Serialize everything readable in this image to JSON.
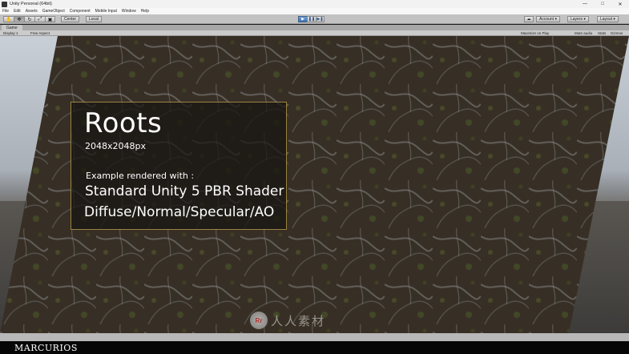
{
  "window": {
    "title": "Unity Personal (64bit)",
    "controls": {
      "minimize": "—",
      "maximize": "□",
      "close": "✕"
    }
  },
  "menu": [
    "File",
    "Edit",
    "Assets",
    "GameObject",
    "Component",
    "Mobile Input",
    "Window",
    "Help"
  ],
  "toolbar": {
    "pivot": "Center",
    "space": "Local",
    "account": "Account",
    "layers": "Layers",
    "layout": "Layout",
    "play_icon": "▶",
    "pause_icon": "❚❚",
    "step_icon": "▶❚"
  },
  "game_view": {
    "tab_label": "Game",
    "display": "Display 1",
    "aspect": "Free Aspect",
    "maximize": "Maximize on Play",
    "mute": "Mute audio",
    "stats": "Stats",
    "gizmos": "Gizmos"
  },
  "overlay": {
    "title": "Roots",
    "resolution": "2048x2048px",
    "rendered_with": "Example rendered with :",
    "shader": "Standard Unity 5 PBR Shader",
    "maps": "Diffuse/Normal/Specular/AO"
  },
  "footer": {
    "brand": "MARCURIOS"
  },
  "watermark": {
    "text": "人人素材"
  },
  "colors": {
    "panel_border": "#9a8240",
    "play_active": "#3c6fb0"
  }
}
